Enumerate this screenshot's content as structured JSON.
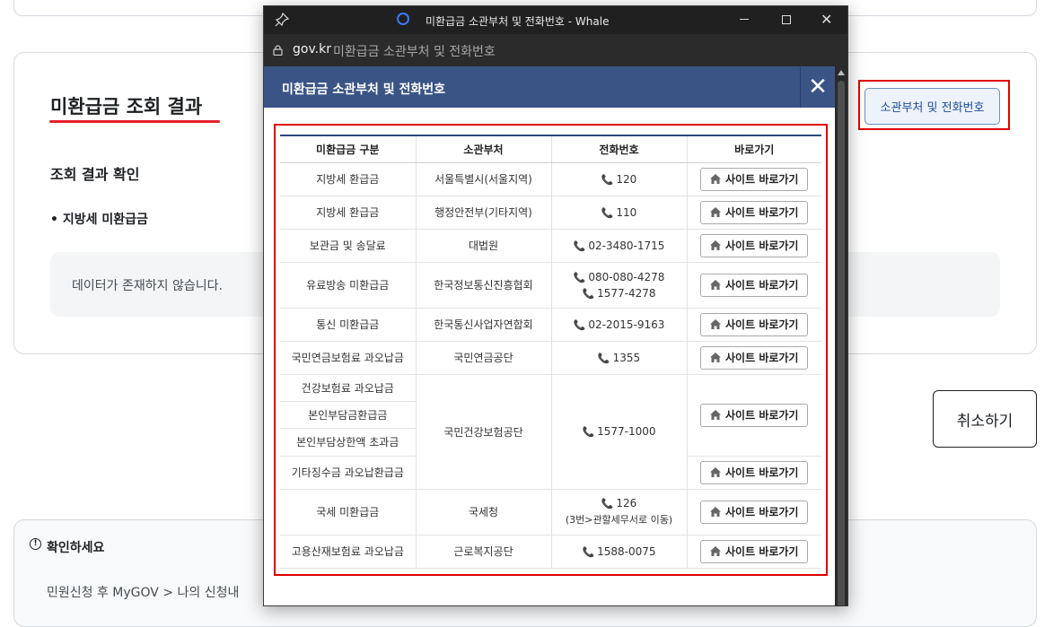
{
  "page": {
    "result_title": "미환급금 조회 결과",
    "sub_title": "조회 결과 확인",
    "bullet_title": "• 지방세 미환급금",
    "empty_message": "데이터가 존재하지 않습니다.",
    "dept_button": "소관부처 및 전화번호",
    "cancel_button": "취소하기",
    "notice_title": "확인하세요",
    "notice_icon": "!",
    "notice_text": "민원신청 후 MyGOV > 나의 신청내"
  },
  "window": {
    "title": "미환급금 소관부처 및 전화번호 - Whale",
    "domain": "gov.kr",
    "page_title": "미환급금 소관부처 및 전화번호",
    "close_glyph": "✕"
  },
  "modal": {
    "title": "미환급금 소관부처 및 전화번호",
    "close_glyph": "✕",
    "headers": [
      "미환급금 구분",
      "소관부처",
      "전화번호",
      "바로가기"
    ],
    "site_button": "사이트 바로가기",
    "rows": [
      {
        "category": "지방세 환급금",
        "dept": "서울특별시(서울지역)",
        "phone": "120"
      },
      {
        "category": "지방세 환급금",
        "dept": "행정안전부(기타지역)",
        "phone": "110"
      },
      {
        "category": "보관금 및 송달료",
        "dept": "대법원",
        "phone": "02-3480-1715"
      },
      {
        "category": "유료방송 미환급금",
        "dept": "한국정보통신진흥협회",
        "phone": "080-080-4278",
        "phone2": "1577-4278"
      },
      {
        "category": "통신 미환급금",
        "dept": "한국통신사업자연합회",
        "phone": "02-2015-9163"
      },
      {
        "category": "국민연금보험료 과오납금",
        "dept": "국민연금공단",
        "phone": "1355"
      },
      {
        "category": "건강보험료 과오납금",
        "dept": "국민건강보험공단",
        "phone": "1577-1000"
      },
      {
        "category": "본인부담금환급금"
      },
      {
        "category": "본인부담상한액 초과금"
      },
      {
        "category": "기타징수금 과오납환급금"
      },
      {
        "category": "국세 미환급금",
        "dept": "국세청",
        "phone": "126",
        "phone_note": "(3번>관할세무서로 이동)"
      },
      {
        "category": "고용산재보험료 과오납금",
        "dept": "근로복지공단",
        "phone": "1588-0075"
      }
    ]
  },
  "colors": {
    "modal_header": "#3a5486",
    "highlight_border": "#e00000",
    "title_underline": "#e5202a",
    "link_blue": "#1d4c9c"
  },
  "icons": [
    "pin-icon",
    "whale-icon",
    "lock-icon",
    "phone-icon",
    "home-icon",
    "close-icon",
    "alert-circle-icon"
  ]
}
